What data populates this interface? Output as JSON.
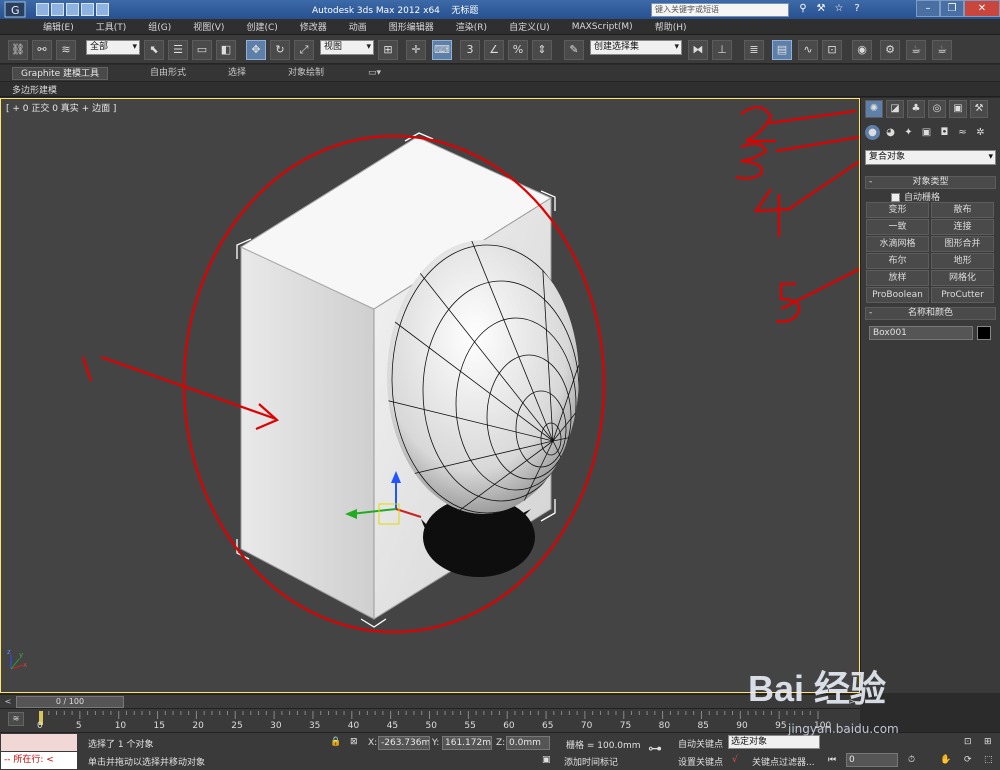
{
  "title_bar": {
    "app_title": "Autodesk 3ds Max  2012 x64",
    "doc_title": "无标题",
    "search_placeholder": "键入关键字或短语",
    "window_buttons": [
      "minimize-icon",
      "restore-icon",
      "close-icon"
    ]
  },
  "menu": {
    "items": [
      "编辑(E)",
      "工具(T)",
      "组(G)",
      "视图(V)",
      "创建(C)",
      "修改器",
      "动画",
      "图形编辑器",
      "渲染(R)",
      "自定义(U)",
      "MAXScript(M)",
      "帮助(H)"
    ]
  },
  "toolbar": {
    "selection_filter": "全部",
    "ref_coord": "视图",
    "named_selection": "创建选择集"
  },
  "ribbon": {
    "tabs": [
      "Graphite 建模工具",
      "自由形式",
      "选择",
      "对象绘制"
    ],
    "active_tab": "Graphite 建模工具",
    "sub_label": "多边形建模"
  },
  "viewport": {
    "label": "[ + 0 正交 0 真实 + 边面 ]",
    "annotations": [
      "1",
      "2",
      "3",
      "4",
      "5"
    ],
    "axis_labels": [
      "x",
      "y",
      "z"
    ]
  },
  "command_panel": {
    "category_dropdown": "复合对象",
    "object_type_header": "对象类型",
    "autogrid_label": "自动栅格",
    "buttons": [
      "变形",
      "散布",
      "一致",
      "连接",
      "水滴网格",
      "图形合并",
      "布尔",
      "地形",
      "放样",
      "网格化",
      "ProBoolean",
      "ProCutter"
    ],
    "name_color_header": "名称和颜色",
    "object_name": "Box001",
    "object_color": "#000000"
  },
  "timeline": {
    "frame_counter": "0 / 100",
    "ticks": [
      "0",
      "5",
      "10",
      "15",
      "20",
      "25",
      "30",
      "35",
      "40",
      "45",
      "50",
      "55",
      "60",
      "65",
      "70",
      "75",
      "80",
      "85",
      "90",
      "95",
      "100"
    ]
  },
  "status": {
    "listener": "所在行:",
    "selection_text": "选择了 1 个对象",
    "prompt_text": "单击并拖动以选择并移动对象",
    "x_label": "X:",
    "x_value": "-263.736m",
    "y_label": "Y:",
    "y_value": "161.172mr",
    "z_label": "Z:",
    "z_value": "0.0mm",
    "grid": "栅格 = 100.0mm",
    "add_time_tag": "添加时间标记",
    "auto_key": "自动关键点",
    "set_key": "设置关键点",
    "selected_dropdown": "选定对象",
    "key_filters": "关键点过滤器...",
    "current_frame": "0"
  },
  "watermark": {
    "brand": "Bai 经验",
    "url": "jingyan.baidu.com"
  }
}
